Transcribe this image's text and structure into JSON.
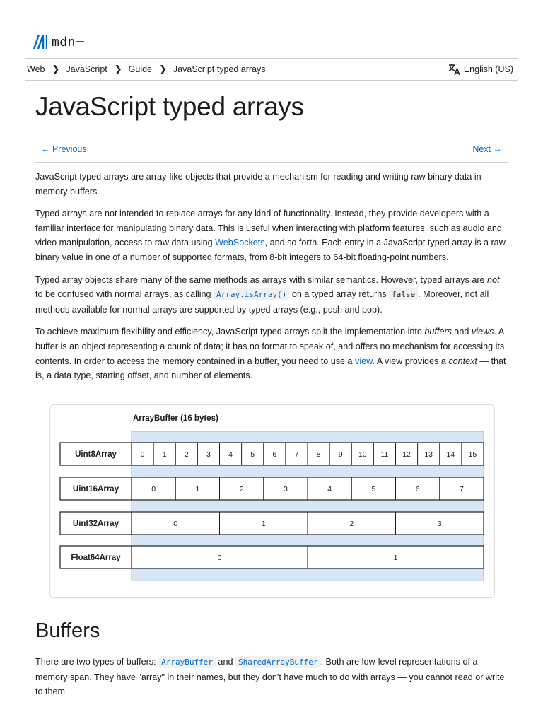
{
  "logo": {
    "text": "mdn"
  },
  "breadcrumb": [
    "Web",
    "JavaScript",
    "Guide",
    "JavaScript typed arrays"
  ],
  "language": "English (US)",
  "title": "JavaScript typed arrays",
  "nav": {
    "previous": "← Previous",
    "next": "Next →"
  },
  "paragraphs": {
    "p1": "JavaScript typed arrays are array-like objects that provide a mechanism for reading and writing raw binary data in memory buffers.",
    "p2_a": "Typed arrays are not intended to replace arrays for any kind of functionality. Instead, they provide developers with a familiar interface for manipulating binary data. This is useful when interacting with platform features, such as audio and video manipulation, access to raw data using ",
    "p2_link": "WebSockets",
    "p2_b": ", and so forth. Each entry in a JavaScript typed array is a raw binary value in one of a number of supported formats, from 8-bit integers to 64-bit floating-point numbers.",
    "p3_a": "Typed array objects share many of the same methods as arrays with similar semantics. However, typed arrays are ",
    "p3_em": "not",
    "p3_b": " to be confused with normal arrays, as calling ",
    "p3_code1": "Array.isArray()",
    "p3_c": " on a typed array returns ",
    "p3_code2": "false",
    "p3_d": ". Moreover, not all methods available for normal arrays are supported by typed arrays (e.g., push and pop).",
    "p4_a": "To achieve maximum flexibility and efficiency, JavaScript typed arrays split the implementation into ",
    "p4_em1": "buffers",
    "p4_b": " and ",
    "p4_em2": "views",
    "p4_c": ". A buffer is an object representing a chunk of data; it has no format to speak of, and offers no mechanism for accessing its contents. In order to access the memory contained in a buffer, you need to use a ",
    "p4_link": "view",
    "p4_d": ". A view provides a ",
    "p4_em3": "context",
    "p4_e": " — that is, a data type, starting offset, and number of elements."
  },
  "diagram": {
    "title": "ArrayBuffer (16 bytes)",
    "rows": [
      {
        "label": "Uint8Array",
        "cells": [
          "0",
          "1",
          "2",
          "3",
          "4",
          "5",
          "6",
          "7",
          "8",
          "9",
          "10",
          "11",
          "12",
          "13",
          "14",
          "15"
        ]
      },
      {
        "label": "Uint16Array",
        "cells": [
          "0",
          "1",
          "2",
          "3",
          "4",
          "5",
          "6",
          "7"
        ]
      },
      {
        "label": "Uint32Array",
        "cells": [
          "0",
          "1",
          "2",
          "3"
        ]
      },
      {
        "label": "Float64Array",
        "cells": [
          "0",
          "1"
        ]
      }
    ],
    "colors": {
      "buffer": "#d7e6f5",
      "line": "#1b1b1b",
      "grid": "#9fb9d6"
    }
  },
  "section": {
    "heading": "Buffers",
    "p_a": "There are two types of buffers: ",
    "code1": "ArrayBuffer",
    "p_b": " and ",
    "code2": "SharedArrayBuffer",
    "p_c": ". Both are low-level representations of a memory span. They have \"array\" in their names, but they don't have much to do with arrays — you cannot read or write to them"
  }
}
